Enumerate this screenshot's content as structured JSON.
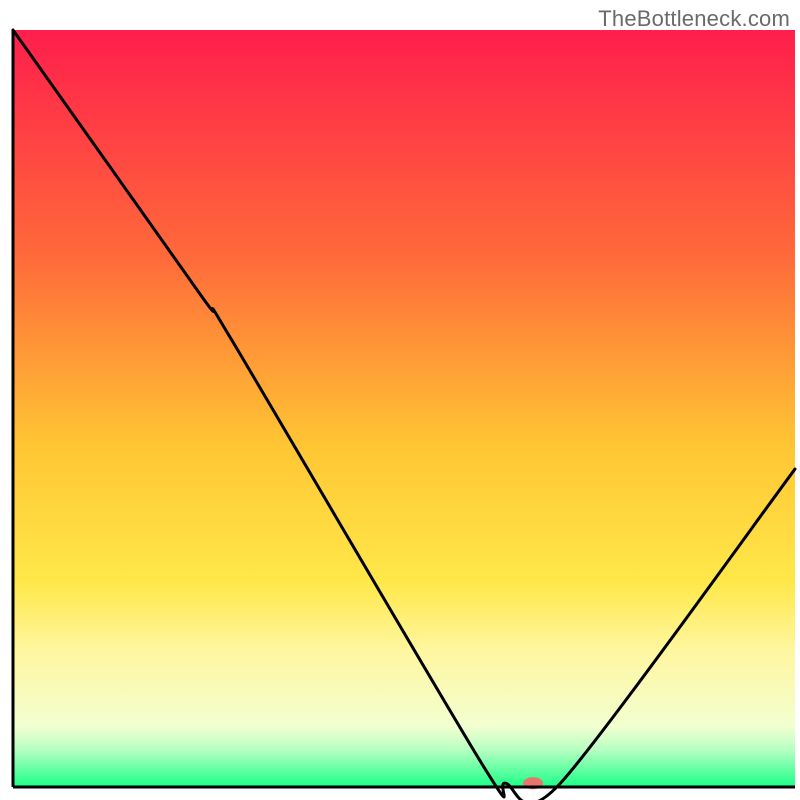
{
  "watermark": "TheBottleneck.com",
  "chart_data": {
    "type": "line",
    "title": "",
    "xlabel": "",
    "ylabel": "",
    "xlim": [
      0,
      100
    ],
    "ylim": [
      0,
      100
    ],
    "grid": false,
    "legend": false,
    "gradient_stops": [
      {
        "offset": 0.0,
        "color": "#ff1e4c"
      },
      {
        "offset": 0.3,
        "color": "#ff6a3a"
      },
      {
        "offset": 0.55,
        "color": "#ffc633"
      },
      {
        "offset": 0.73,
        "color": "#ffe84a"
      },
      {
        "offset": 0.82,
        "color": "#fff6a0"
      },
      {
        "offset": 0.92,
        "color": "#f2ffd0"
      },
      {
        "offset": 0.95,
        "color": "#b9ffc2"
      },
      {
        "offset": 1.0,
        "color": "#1bff87"
      }
    ],
    "axis_color": "#000000",
    "curve": {
      "name": "bottleneck-curve",
      "stroke": "#000000",
      "stroke_width": 3,
      "points": [
        {
          "x": 0.0,
          "y": 100.0
        },
        {
          "x": 24.0,
          "y": 65.0
        },
        {
          "x": 28.0,
          "y": 59.0
        },
        {
          "x": 60.0,
          "y": 3.0
        },
        {
          "x": 63.0,
          "y": 0.5
        },
        {
          "x": 70.0,
          "y": 0.5
        },
        {
          "x": 100.0,
          "y": 42.0
        }
      ]
    },
    "marker": {
      "name": "optimal-point",
      "x": 66.5,
      "y": 0.5,
      "rx": 10,
      "ry": 6,
      "color": "#e8766d"
    }
  }
}
